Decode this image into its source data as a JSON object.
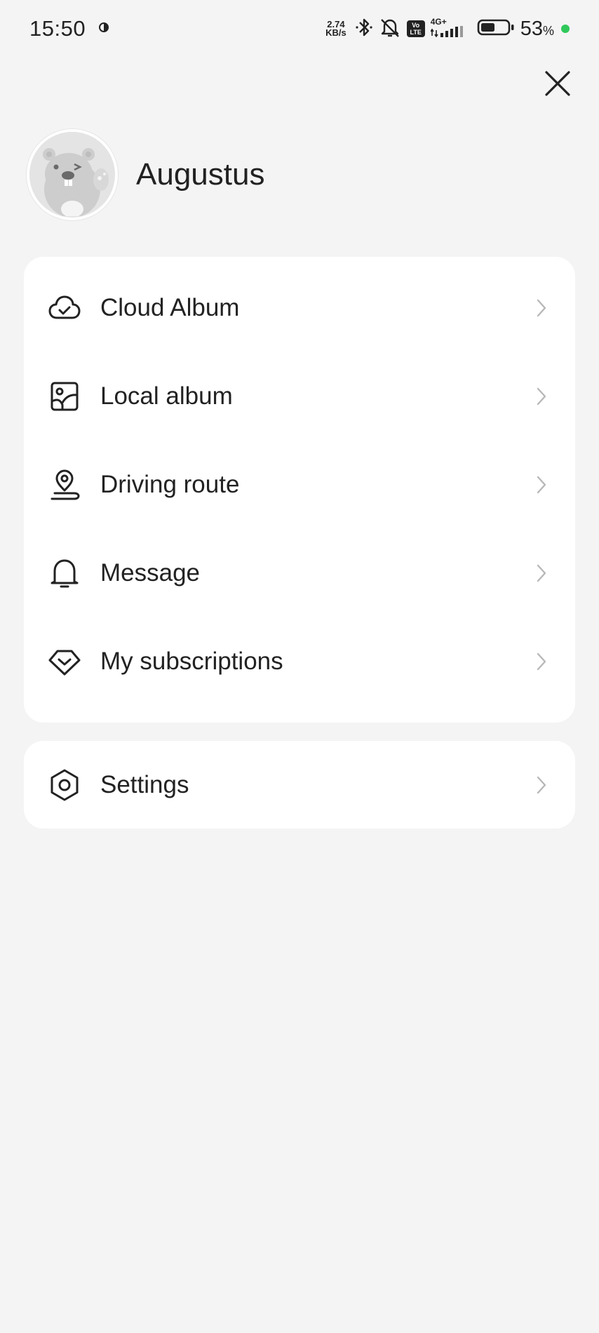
{
  "status_bar": {
    "time": "15:50",
    "net_speed_value": "2.74",
    "net_speed_unit": "KB/s",
    "volte_top": "Vo",
    "volte_bottom": "LTE",
    "network_type": "4G+",
    "battery_percent": "53",
    "battery_percent_symbol": "%",
    "battery_level": 0.53,
    "charge_dot_color": "#2fc85a"
  },
  "profile": {
    "user_name": "Augustus",
    "avatar_icon": "beaver-avatar-icon"
  },
  "menu": {
    "items": [
      {
        "label": "Cloud Album",
        "icon": "cloud-check-icon"
      },
      {
        "label": "Local album",
        "icon": "image-icon"
      },
      {
        "label": "Driving route",
        "icon": "location-pin-icon"
      },
      {
        "label": "Message",
        "icon": "bell-icon"
      },
      {
        "label": "My subscriptions",
        "icon": "diamond-check-icon"
      }
    ]
  },
  "settings": {
    "label": "Settings",
    "icon": "hexagon-gear-icon"
  },
  "colors": {
    "background": "#f4f4f4",
    "card": "#ffffff",
    "text": "#222222",
    "chevron": "#b8b8b8"
  }
}
